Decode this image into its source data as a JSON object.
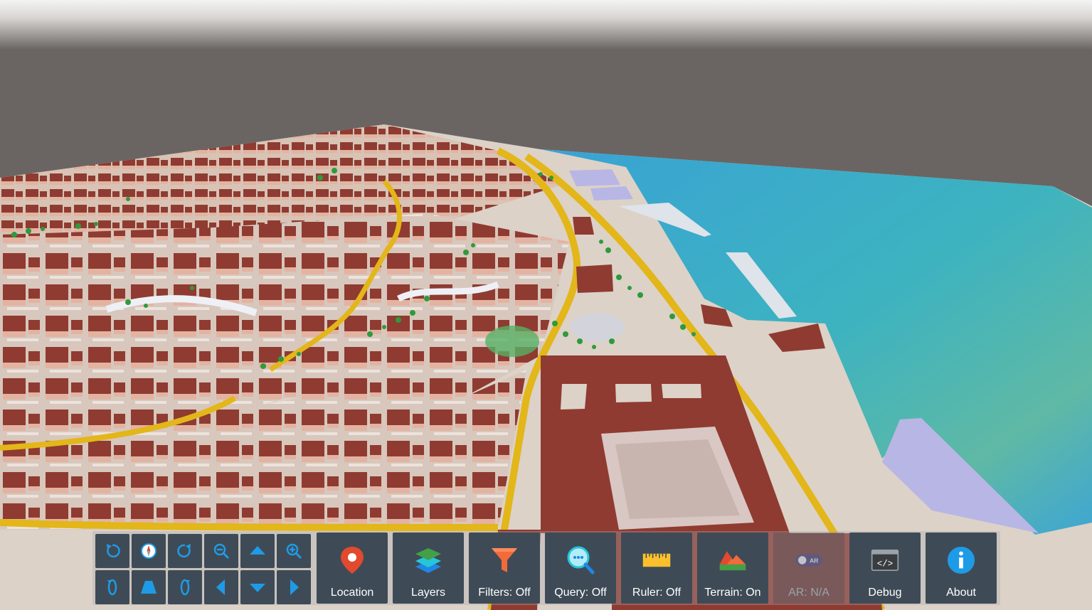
{
  "map": {
    "colors": {
      "sky": "#f2f2f2",
      "background": "#6a6563",
      "roof": "#8f3b31",
      "wall": "#e0b3a0",
      "road": "#e3b619",
      "ground": "#dcd2c8",
      "sea": "#3aa0d6",
      "tree": "#2f9a3c"
    }
  },
  "toolbar": {
    "nav": [
      {
        "name": "rotate-left-button",
        "icon": "rotate-left-icon"
      },
      {
        "name": "compass-button",
        "icon": "compass-icon"
      },
      {
        "name": "rotate-right-button",
        "icon": "rotate-right-icon"
      },
      {
        "name": "zoom-out-button",
        "icon": "zoom-out-icon"
      },
      {
        "name": "pan-up-button",
        "icon": "arrow-up-icon"
      },
      {
        "name": "zoom-in-button",
        "icon": "zoom-in-icon"
      },
      {
        "name": "orbit-left-button",
        "icon": "orbit-left-icon"
      },
      {
        "name": "tilt-button",
        "icon": "trapezoid-icon"
      },
      {
        "name": "orbit-right-button",
        "icon": "orbit-right-icon"
      },
      {
        "name": "pan-left-button",
        "icon": "arrow-left-icon"
      },
      {
        "name": "pan-down-button",
        "icon": "arrow-down-icon"
      },
      {
        "name": "pan-right-button",
        "icon": "arrow-right-icon"
      }
    ],
    "tools": [
      {
        "label": "Location",
        "icon": "map-pin-icon"
      },
      {
        "label": "Layers",
        "icon": "layers-icon"
      },
      {
        "label": "Filters: Off",
        "icon": "funnel-icon"
      },
      {
        "label": "Query: Off",
        "icon": "search-icon"
      },
      {
        "label": "Ruler: Off",
        "icon": "ruler-icon"
      },
      {
        "label": "Terrain: On",
        "icon": "mountain-icon"
      },
      {
        "label": "AR: N/A",
        "icon": "ar-toggle-icon",
        "badge": "AR"
      },
      {
        "label": "Debug",
        "icon": "code-window-icon"
      },
      {
        "label": "About",
        "icon": "info-icon"
      }
    ]
  }
}
